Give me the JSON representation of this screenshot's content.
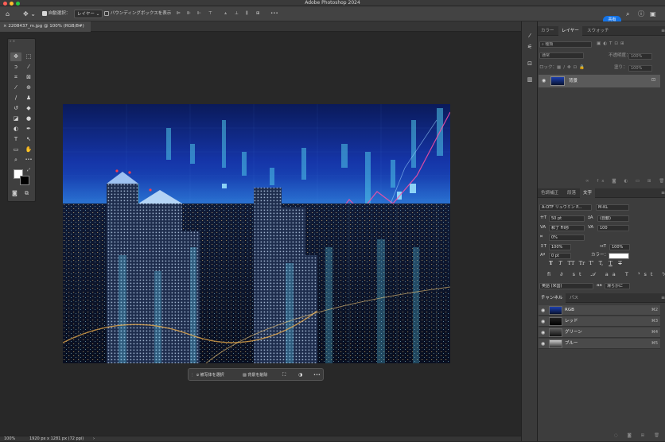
{
  "app": {
    "title": "Adobe Photoshop 2024"
  },
  "traffic": {
    "close": "#ff5f57",
    "min": "#febc2e",
    "max": "#28c840"
  },
  "options": {
    "auto_select_label": "自動選択：",
    "auto_select_value": "レイヤー",
    "bbox_label": "バウンディングボックスを表示",
    "more": "•••",
    "share": "共有"
  },
  "document": {
    "tab_label": "2208437_m.jpg @ 100% (RGB/8#)",
    "close": "×"
  },
  "toolbox": {
    "tools": [
      {
        "name": "move-tool",
        "glyph": "✥"
      },
      {
        "name": "marquee-tool",
        "glyph": "⬚"
      },
      {
        "name": "lasso-tool",
        "glyph": "ↄ"
      },
      {
        "name": "quick-select-tool",
        "glyph": "⁄"
      },
      {
        "name": "crop-tool",
        "glyph": "⌗"
      },
      {
        "name": "frame-tool",
        "glyph": "⊠"
      },
      {
        "name": "eyedropper-tool",
        "glyph": "⁄"
      },
      {
        "name": "healing-tool",
        "glyph": "⊕"
      },
      {
        "name": "brush-tool",
        "glyph": "∕"
      },
      {
        "name": "stamp-tool",
        "glyph": "♟"
      },
      {
        "name": "history-brush-tool",
        "glyph": "↺"
      },
      {
        "name": "eraser-tool",
        "glyph": "◆"
      },
      {
        "name": "gradient-tool",
        "glyph": "◪"
      },
      {
        "name": "blur-tool",
        "glyph": "●"
      },
      {
        "name": "dodge-tool",
        "glyph": "◐"
      },
      {
        "name": "pen-tool",
        "glyph": "✒"
      },
      {
        "name": "type-tool",
        "glyph": "T"
      },
      {
        "name": "path-select-tool",
        "glyph": "↖"
      },
      {
        "name": "shape-tool",
        "glyph": "▭"
      },
      {
        "name": "hand-tool",
        "glyph": "✋"
      },
      {
        "name": "zoom-tool",
        "glyph": "⌕"
      },
      {
        "name": "more-tools",
        "glyph": "•••"
      }
    ]
  },
  "contextbar": {
    "select_subject": "被写体を選択",
    "remove_bg": "背景を削除",
    "more": "•••"
  },
  "status": {
    "zoom": "100%",
    "dims": "1920 px x 1281 px (72 ppi)"
  },
  "panel_top": {
    "tabs": [
      "カラー",
      "レイヤー",
      "スウォッチ"
    ],
    "active_tab": 1,
    "search_kind": "種類",
    "blend_mode": "通常",
    "opacity_label": "不透明度：",
    "opacity_value": "100%",
    "lock_label": "ロック：",
    "fill_label": "塗り：",
    "fill_value": "100%",
    "layer_name": "背景"
  },
  "panel_mid": {
    "tabs": [
      "色調補正",
      "段落",
      "文字"
    ],
    "active_tab": 2,
    "font_family": "A-OTF リュウミン P...",
    "font_style": "M-KL",
    "font_size": "50 pt",
    "leading": "(自動)",
    "kerning": "和了 Fit秒",
    "tracking": "100",
    "tsume": "0%",
    "vscale": "100%",
    "hscale": "100%",
    "baseline": "0 pt",
    "color_label": "カラー：",
    "text_color": "#ffffff",
    "language": "英語 (米国)",
    "aa_label": "aa",
    "antialias": "滑らかに",
    "style_buttons": [
      "T",
      "T",
      "TT",
      "Tr",
      "T'",
      "T,",
      "T",
      "T"
    ]
  },
  "channels": {
    "tabs": [
      "チャンネル",
      "パス"
    ],
    "active_tab": 0,
    "rows": [
      {
        "name": "RGB",
        "shortcut": "⌘2"
      },
      {
        "name": "レッド",
        "shortcut": "⌘3"
      },
      {
        "name": "グリーン",
        "shortcut": "⌘4"
      },
      {
        "name": "ブルー",
        "shortcut": "⌘5"
      }
    ]
  }
}
